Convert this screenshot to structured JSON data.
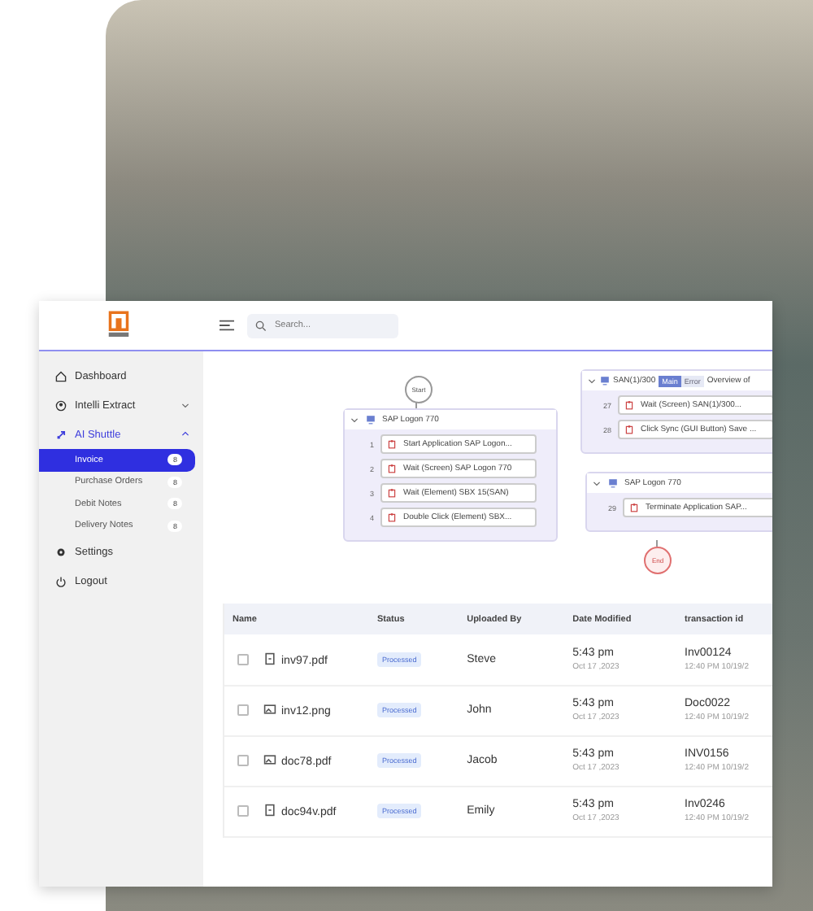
{
  "sidebar": {
    "items": [
      {
        "label": "Dashboard",
        "kind": "item",
        "selected": false
      },
      {
        "label": "Intelli Extract",
        "kind": "group",
        "expanded": false,
        "selected": false
      },
      {
        "label": "AI Shuttle",
        "kind": "group",
        "expanded": true,
        "selected": true,
        "children": [
          {
            "label": "Invoice",
            "count": "8",
            "selected": true
          },
          {
            "label": "Purchase Orders",
            "count": "8",
            "selected": false
          },
          {
            "label": "Debit Notes",
            "count": "8",
            "selected": false
          },
          {
            "label": "Delivery Notes",
            "count": "8",
            "selected": false
          }
        ]
      },
      {
        "label": "Settings",
        "kind": "item",
        "selected": false
      },
      {
        "label": "Logout",
        "kind": "item",
        "selected": false
      }
    ]
  },
  "search": {
    "placeholder": "Search..."
  },
  "flow": {
    "start": "Start",
    "end": "End",
    "groups": [
      {
        "title": "SAP Logon 770",
        "steps": [
          {
            "number": "1",
            "label": "Start Application SAP Logon..."
          },
          {
            "number": "2",
            "label": "Wait (Screen) SAP Logon 770"
          },
          {
            "number": "3",
            "label": "Wait (Element) SBX 15(SAN)"
          },
          {
            "number": "4",
            "label": "Double Click (Element) SBX..."
          }
        ]
      },
      {
        "title": "SAN(1)/300",
        "title_end": "Overview of",
        "tabs": [
          {
            "label": "Main",
            "selected": true
          },
          {
            "label": "Error",
            "selected": false
          }
        ],
        "steps": [
          {
            "number": "27",
            "label": "Wait (Screen) SAN(1)/300..."
          },
          {
            "number": "28",
            "label": "Click Sync (GUI Button) Save ..."
          }
        ]
      },
      {
        "title": "SAP Logon 770",
        "steps": [
          {
            "number": "29",
            "label": "Terminate Application SAP..."
          }
        ]
      }
    ]
  },
  "table": {
    "columns": [
      "Name",
      "Status",
      "Uploaded By",
      "Date Modified",
      "transaction id"
    ],
    "rows": [
      {
        "checked": false,
        "kind": "document",
        "name": "inv97.pdf",
        "status": "Processed",
        "uploaded_by": "Steve",
        "time": "5:43 pm",
        "date": "Oct 17 ,2023",
        "transaction_id": "Inv00124",
        "transaction_time": "12:40 PM 10/19/2"
      },
      {
        "checked": false,
        "kind": "image",
        "name": "inv12.png",
        "status": "Processed",
        "uploaded_by": "John",
        "time": "5:43 pm",
        "date": "Oct 17 ,2023",
        "transaction_id": "Doc0022",
        "transaction_time": "12:40 PM 10/19/2"
      },
      {
        "checked": false,
        "kind": "image",
        "name": "doc78.pdf",
        "status": "Processed",
        "uploaded_by": "Jacob",
        "time": "5:43 pm",
        "date": "Oct 17 ,2023",
        "transaction_id": "INV0156",
        "transaction_time": "12:40 PM 10/19/2"
      },
      {
        "checked": false,
        "kind": "document",
        "name": "doc94v.pdf",
        "status": "Processed",
        "uploaded_by": "Emily",
        "time": "5:43 pm",
        "date": "Oct 17 ,2023",
        "transaction_id": "Inv0246",
        "transaction_time": "12:40 PM 10/19/2"
      }
    ]
  }
}
